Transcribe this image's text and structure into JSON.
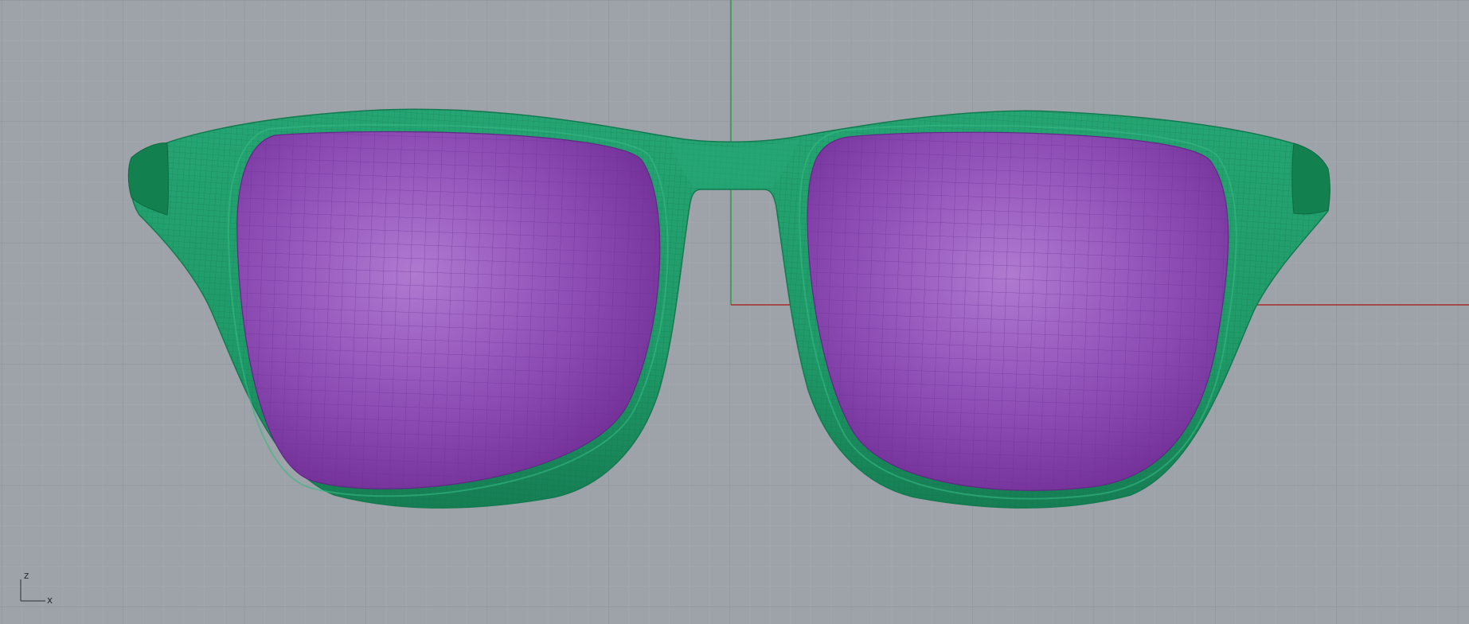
{
  "viewport": {
    "background": "#9ea3aa",
    "grid_minor_color": "#a7abb1",
    "grid_major_color": "#8e939a",
    "x_axis_color": "#a32c2c",
    "y_axis_color": "#2f9a3a"
  },
  "axis_widget": {
    "z_label": "z",
    "x_label": "x"
  },
  "model": {
    "name": "sunglasses",
    "frame_color": "#1f9a68",
    "frame_mesh_color": "#0f6a44",
    "lens_color": "#8a4bb0",
    "lens_mesh_color": "#6c2f96"
  }
}
